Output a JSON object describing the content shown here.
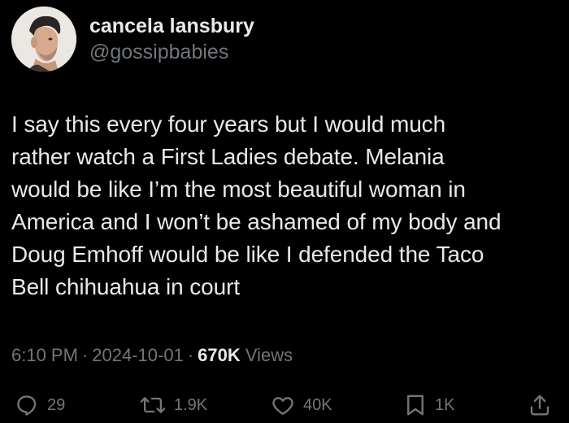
{
  "user": {
    "display_name": "cancela lansbury",
    "handle": "@gossipbabies"
  },
  "tweet": {
    "lines": [
      "I say this every four years but I would much",
      "rather watch a First Ladies debate. Melania",
      "would be like I’m the most beautiful woman in",
      "America and I won’t be ashamed of my body and",
      "Doug Emhoff would be like I defended the Taco",
      "Bell chihuahua in court"
    ],
    "time": "6:10 PM",
    "date": "2024-10-01",
    "separator": "·",
    "views_count": "670K",
    "views_label": "Views"
  },
  "actions": {
    "replies": "29",
    "retweets": "1.9K",
    "likes": "40K",
    "bookmarks": "1K"
  },
  "icons": {
    "reply": "reply-icon",
    "retweet": "retweet-icon",
    "like": "heart-icon",
    "bookmark": "bookmark-icon",
    "share": "share-icon"
  },
  "colors": {
    "background": "#000000",
    "primary_text": "#e7e9ea",
    "secondary_text": "#71767b"
  }
}
